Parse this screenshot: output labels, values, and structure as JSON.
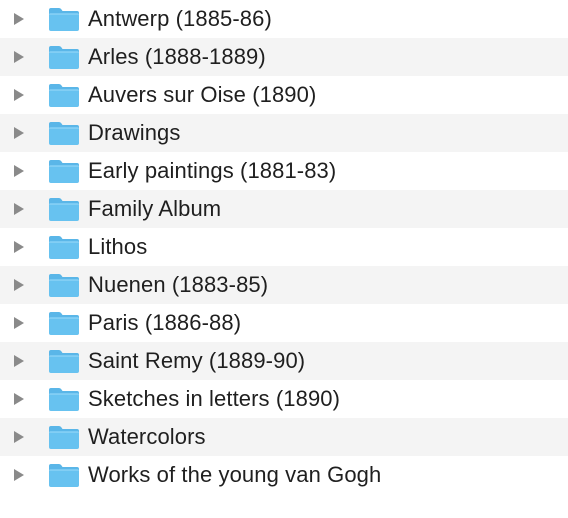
{
  "colors": {
    "folder_body": "#67c2f0",
    "folder_tab": "#5ab6e8",
    "folder_edge": "#8fd3f6",
    "disclosure": "#8a8a8a",
    "row_alt": "#f4f4f4",
    "text": "#1f1f1f"
  },
  "icons": {
    "disclosure": "disclosure-triangle-icon",
    "folder": "folder-icon"
  },
  "items": [
    {
      "label": "Antwerp (1885-86)"
    },
    {
      "label": "Arles (1888-1889)"
    },
    {
      "label": "Auvers sur Oise (1890)"
    },
    {
      "label": "Drawings"
    },
    {
      "label": "Early paintings (1881-83)"
    },
    {
      "label": "Family Album"
    },
    {
      "label": "Lithos"
    },
    {
      "label": "Nuenen (1883-85)"
    },
    {
      "label": "Paris (1886-88)"
    },
    {
      "label": "Saint Remy (1889-90)"
    },
    {
      "label": "Sketches in letters (1890)"
    },
    {
      "label": "Watercolors"
    },
    {
      "label": "Works of the young van Gogh"
    }
  ]
}
